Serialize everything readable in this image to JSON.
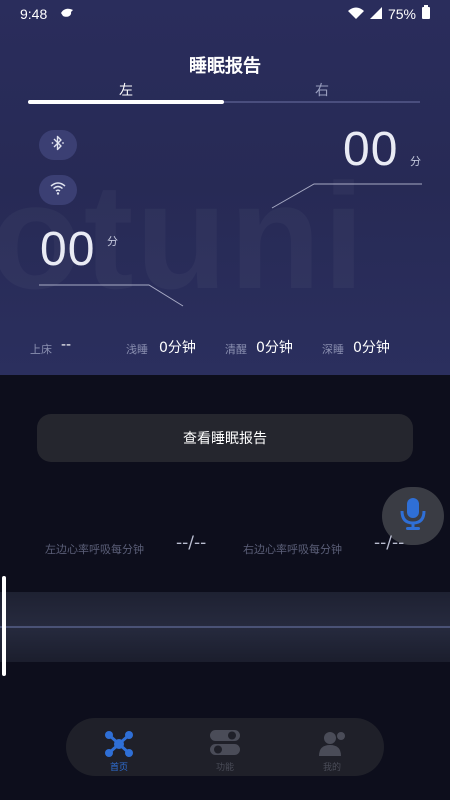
{
  "status": {
    "time": "9:48",
    "battery": "75%"
  },
  "page": {
    "title": "睡眠报告"
  },
  "tabs": [
    {
      "label": "左"
    },
    {
      "label": "右"
    }
  ],
  "watermark": "otuni",
  "right_side": {
    "value": "00",
    "unit": "分"
  },
  "left_side": {
    "value": "00",
    "unit": "分"
  },
  "stats": [
    {
      "label": "上床",
      "value": "--"
    },
    {
      "label": "浅睡",
      "value": "0分钟"
    },
    {
      "label": "清醒",
      "value": "0分钟"
    },
    {
      "label": "深睡",
      "value": "0分钟"
    }
  ],
  "report_button": {
    "label": "查看睡眠报告"
  },
  "heart_rate": {
    "left_label": "左边心率呼吸每分钟",
    "left_value": "--/--",
    "right_label": "右边心率呼吸每分钟",
    "right_value": "--/--"
  },
  "nav": [
    {
      "label": "首页",
      "icon": "home-nodes-icon",
      "active": true
    },
    {
      "label": "功能",
      "icon": "toggles-icon",
      "active": false
    },
    {
      "label": "我的",
      "icon": "user-icon",
      "active": false
    }
  ],
  "colors": {
    "accent": "#2f6fd6",
    "panel": "#2a2d5c",
    "background": "#0d0e1c"
  }
}
